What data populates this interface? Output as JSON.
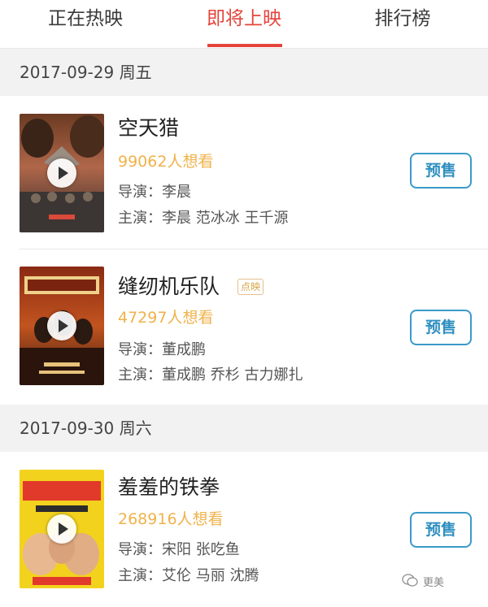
{
  "tabs": [
    {
      "label": "正在热映"
    },
    {
      "label": "即将上映"
    },
    {
      "label": "排行榜"
    }
  ],
  "active_tab": 1,
  "accent_color": "#e5443c",
  "want_color": "#f0b24a",
  "button_color": "#3a9ac9",
  "sections": [
    {
      "date": "2017-09-29 周五"
    },
    {
      "date": "2017-09-30 周六"
    }
  ],
  "movies": [
    {
      "title": "空天猎",
      "badge": "",
      "want": "99062人想看",
      "director": "导演：李晨",
      "cast": "主演：李晨 范冰冰 王千源",
      "button": "预售"
    },
    {
      "title": "缝纫机乐队",
      "badge": "点映",
      "want": "47297人想看",
      "director": "导演：董成鹏",
      "cast": "主演：董成鹏 乔杉 古力娜扎",
      "button": "预售"
    },
    {
      "title": "羞羞的铁拳",
      "badge": "",
      "want": "268916人想看",
      "director": "导演：宋阳 张吃鱼",
      "cast": "主演：艾伦 马丽 沈腾",
      "button": "预售"
    }
  ],
  "watermark": {
    "text": "更美",
    "icon": "wechat-icon"
  }
}
